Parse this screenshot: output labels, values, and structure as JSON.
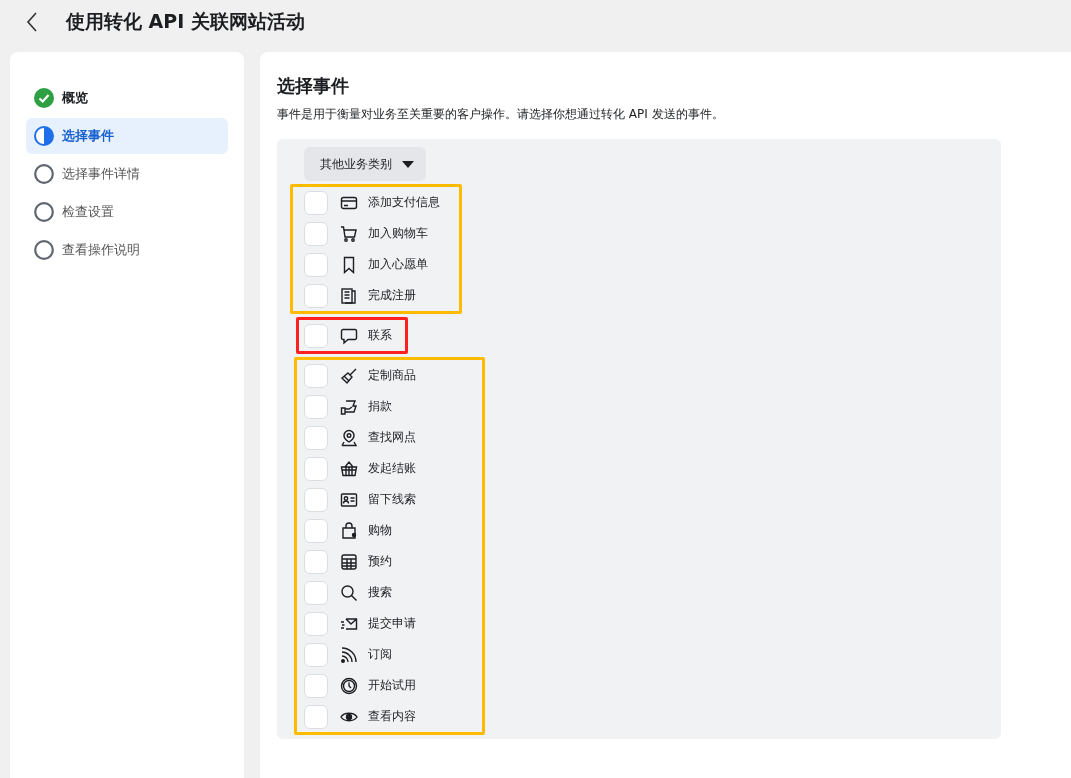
{
  "header": {
    "title": "使用转化 API 关联网站活动"
  },
  "steps": [
    {
      "label": "概览",
      "kind": "done",
      "selected": false
    },
    {
      "label": "选择事件",
      "kind": "current",
      "selected": true
    },
    {
      "label": "选择事件详情",
      "kind": "todo",
      "selected": false
    },
    {
      "label": "检查设置",
      "kind": "todo",
      "selected": false
    },
    {
      "label": "查看操作说明",
      "kind": "todo",
      "selected": false
    }
  ],
  "main": {
    "title": "选择事件",
    "description": "事件是用于衡量对业务至关重要的客户操作。请选择你想通过转化 API 发送的事件。",
    "category_dropdown": "其他业务类别"
  },
  "event_groups": [
    {
      "color": "#ffbb00",
      "events": [
        {
          "label": "添加支付信息",
          "kind": "card",
          "checked": false
        },
        {
          "label": "加入购物车",
          "kind": "cart",
          "checked": false
        },
        {
          "label": "加入心愿单",
          "kind": "bookmark",
          "checked": false
        },
        {
          "label": "完成注册",
          "kind": "form",
          "checked": false
        }
      ]
    },
    {
      "color": "#ff2020",
      "events": [
        {
          "label": "联系",
          "kind": "chat",
          "checked": false
        }
      ]
    },
    {
      "color": "#ffbb00",
      "events": [
        {
          "label": "定制商品",
          "kind": "brush",
          "checked": false
        },
        {
          "label": "捐款",
          "kind": "donate",
          "checked": false
        },
        {
          "label": "查找网点",
          "kind": "pin",
          "checked": false
        },
        {
          "label": "发起结账",
          "kind": "basket",
          "checked": false
        },
        {
          "label": "留下线索",
          "kind": "idcard",
          "checked": false
        },
        {
          "label": "购物",
          "kind": "bag",
          "checked": false
        },
        {
          "label": "预约",
          "kind": "calendar",
          "checked": false
        },
        {
          "label": "搜索",
          "kind": "search",
          "checked": false
        },
        {
          "label": "提交申请",
          "kind": "mail",
          "checked": false
        },
        {
          "label": "订阅",
          "kind": "rss",
          "checked": false
        },
        {
          "label": "开始试用",
          "kind": "clock",
          "checked": false
        },
        {
          "label": "查看内容",
          "kind": "eye",
          "checked": false
        }
      ]
    }
  ]
}
